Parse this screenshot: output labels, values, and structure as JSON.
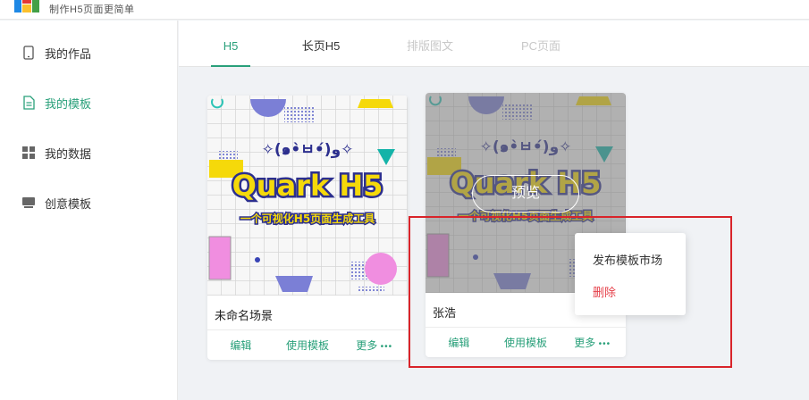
{
  "brand": {
    "tagline": "制作H5页面更简单",
    "logo_colors": [
      "#1e88e5",
      "#e53935",
      "#fbc02d",
      "#43a047"
    ]
  },
  "accent_color": "#29a07a",
  "sidebar": {
    "items": [
      {
        "label": "我的作品",
        "icon": "phone-icon",
        "active": false
      },
      {
        "label": "我的模板",
        "icon": "document-icon",
        "active": true
      },
      {
        "label": "我的数据",
        "icon": "grid-icon",
        "active": false
      },
      {
        "label": "创意模板",
        "icon": "monitor-icon",
        "active": false
      }
    ]
  },
  "tabs": [
    {
      "label": "H5",
      "state": "active"
    },
    {
      "label": "长页H5",
      "state": "normal"
    },
    {
      "label": "排版图文",
      "state": "disabled"
    },
    {
      "label": "PC页面",
      "state": "disabled"
    }
  ],
  "thumbnail": {
    "kaomoji": "✧(๑•̀ㅂ•́)و✧",
    "title": "Quark H5",
    "subtitle": "一个可视化H5页面生成工具"
  },
  "cards": [
    {
      "name": "未命名场景",
      "actions": {
        "edit": "编辑",
        "use": "使用模板",
        "more": "更多",
        "more_dots": "•••"
      }
    },
    {
      "name": "张浩",
      "preview_label": "预览",
      "actions": {
        "edit": "编辑",
        "use": "使用模板",
        "more": "更多",
        "more_dots": "•••"
      }
    }
  ],
  "popup_menu": {
    "publish": "发布模板市场",
    "delete": "删除",
    "delete_color": "#e5404a"
  }
}
